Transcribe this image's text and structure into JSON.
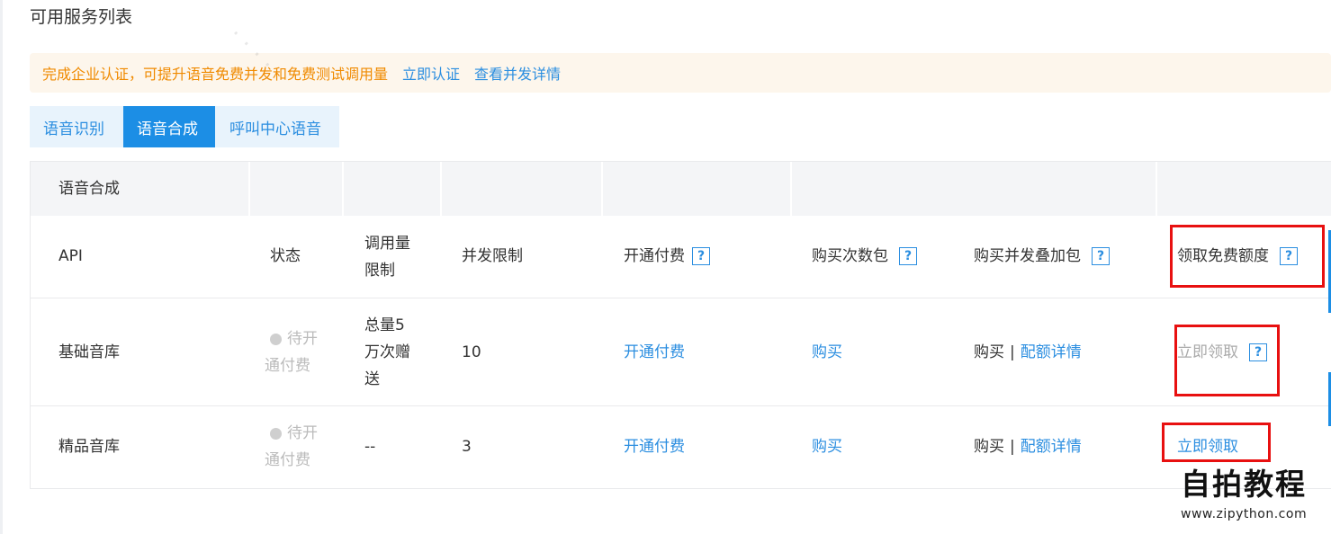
{
  "page_title": "可用服务列表",
  "notice": {
    "message": "完成企业认证，可提升语音免费并发和免费测试调用量",
    "certify_link": "立即认证",
    "details_link": "查看并发详情"
  },
  "tabs": [
    {
      "label": "语音识别",
      "active": false
    },
    {
      "label": "语音合成",
      "active": true
    },
    {
      "label": "呼叫中心语音",
      "active": false
    }
  ],
  "table": {
    "group_title": "语音合成",
    "columns": {
      "api": "API",
      "status": "状态",
      "call_limit": "调用量\n限制",
      "concurrency": "并发限制",
      "enable_pay": "开通付费",
      "buy_pack": "购买次数包",
      "buy_concurrency": "购买并发叠加包",
      "free_quota": "领取免费额度"
    },
    "help_glyph": "?",
    "rows": [
      {
        "api": "基础音库",
        "status": "待开\n通付费",
        "call_limit": "总量5\n万次赠\n送",
        "concurrency": "10",
        "enable_pay": "开通付费",
        "buy_pack": "购买",
        "buy_concurrency": "购买",
        "quota_details": "配额详情",
        "free_quota": "立即领取"
      },
      {
        "api": "精品音库",
        "status": "待开\n通付费",
        "call_limit": "--",
        "concurrency": "3",
        "enable_pay": "开通付费",
        "buy_pack": "购买",
        "buy_concurrency": "购买",
        "quota_details": "配额详情",
        "free_quota": "立即领取"
      }
    ]
  },
  "logo": {
    "text": "自拍教程",
    "url": "www.zipython.com"
  },
  "colors": {
    "accent": "#1c8ee5",
    "link": "#2b8ee0",
    "warning": "#f08a00",
    "annotation": "#e81010"
  }
}
